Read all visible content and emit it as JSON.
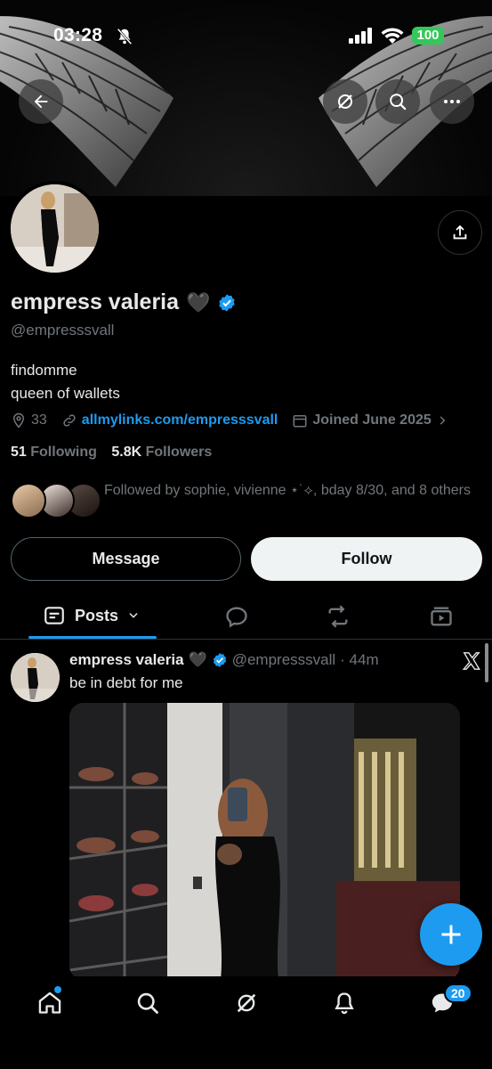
{
  "status_bar": {
    "time": "03:28",
    "battery": "100"
  },
  "profile": {
    "display_name": "empress valeria",
    "name_emoji": "🖤",
    "handle": "@empresssvall",
    "bio_line1": "findomme",
    "bio_line2": "queen of wallets",
    "location": "33",
    "link": "allmylinks.com/empresssvall",
    "joined": "Joined June 2025",
    "following_count": "51",
    "following_label": "Following",
    "followers_count": "5.8K",
    "followers_label": "Followers",
    "followed_by": "Followed by sophie, vivienne ⋆˙⟡, bday 8/30, and 8 others"
  },
  "actions": {
    "message": "Message",
    "follow": "Follow"
  },
  "tabs": {
    "posts": "Posts"
  },
  "post": {
    "name": "empress valeria",
    "name_emoji": "🖤",
    "handle": "@empresssvall",
    "time": "· 44m",
    "text": "be in debt for me"
  },
  "nav": {
    "messages_badge": "20"
  },
  "colors": {
    "accent": "#1d9bf0",
    "muted": "#71767b",
    "text": "#e7e9ea",
    "background": "#000000"
  }
}
